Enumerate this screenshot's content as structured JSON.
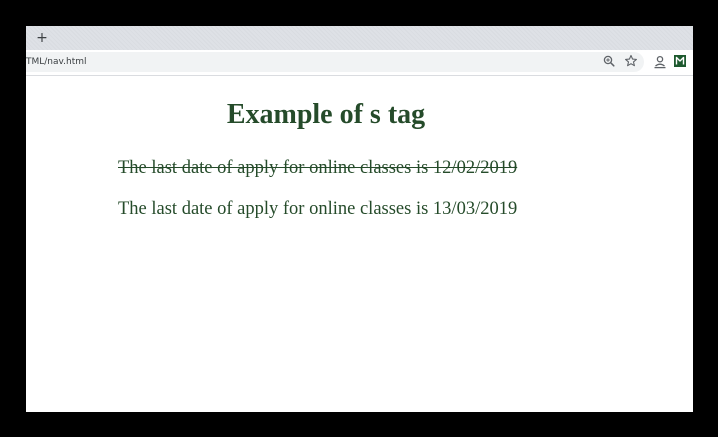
{
  "browser": {
    "new_tab_label": "+",
    "address_bar": {
      "url": "TML/nav.html"
    },
    "toolbar_icons": [
      "zoom-icon",
      "bookmark-star-icon",
      "profile-icon",
      "extension-icon"
    ],
    "extension_color": "#1e5a2f"
  },
  "page": {
    "heading": "Example of s tag",
    "old_date_text": "The last date of apply for online classes is 12/02/2019",
    "new_date_text": "The last date of apply for online classes is 13/03/2019",
    "text_color": "#254b2a"
  }
}
